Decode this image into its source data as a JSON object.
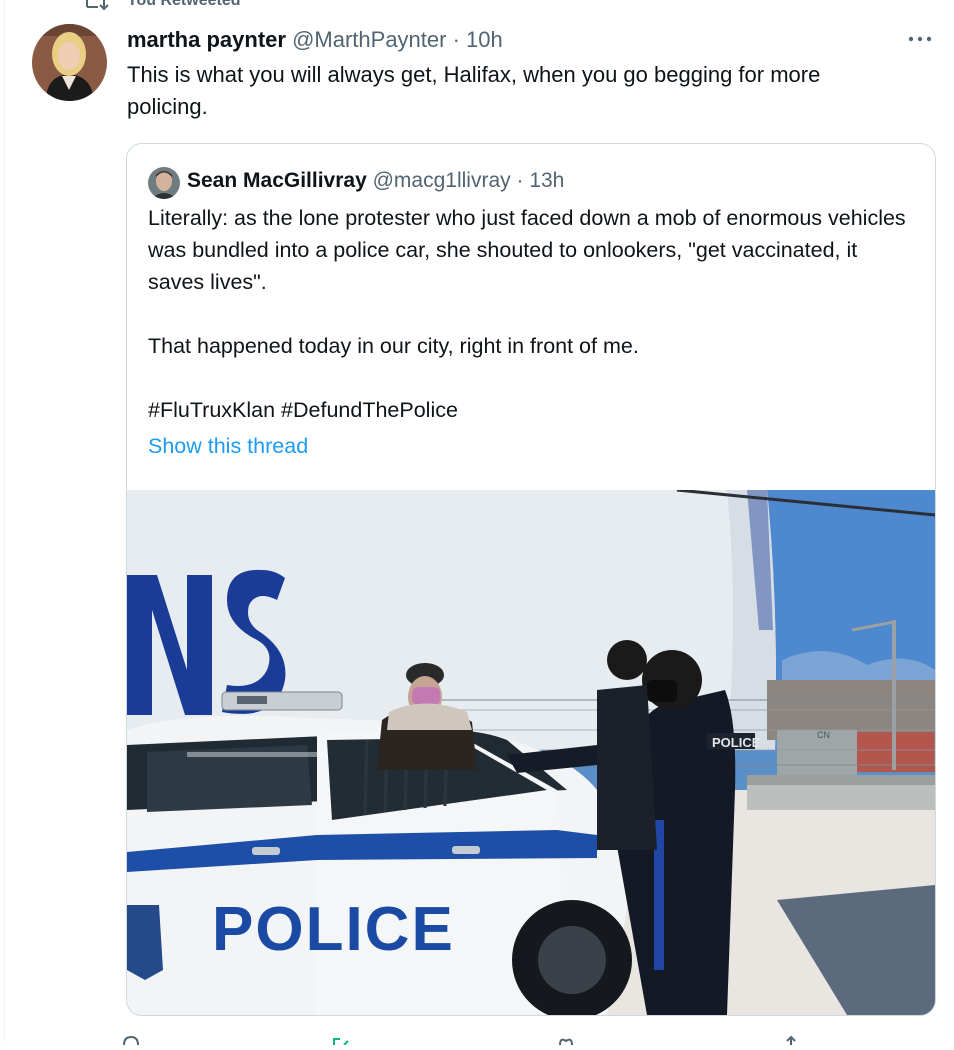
{
  "retweet": {
    "label": "You Retweeted",
    "icon": "retweet-icon"
  },
  "tweet": {
    "author_name": "martha paynter",
    "author_handle": "@MarthPaynter",
    "separator": "·",
    "time": "10h",
    "text": "This is what you will always get, Halifax, when you go begging for more policing.",
    "more_icon": "more-horizontal-icon"
  },
  "quote": {
    "author_name": "Sean MacGillivray",
    "author_handle": "@macg1llivray",
    "separator": "·",
    "time": "13h",
    "paragraph_1": "Literally: as the lone protester who just faced down a mob of enormous vehicles was bundled into a police car, she shouted to onlookers, \"get vaccinated, it saves lives\".",
    "paragraph_2": "That happened today in our city, right in front of me.",
    "paragraph_3": "#FluTruxKlan #DefundThePolice",
    "show_thread": "Show this thread",
    "media": {
      "wall_text": "NS",
      "car_text": "POLICE",
      "vest_text": "POLICE",
      "tank_text": "CN"
    }
  },
  "actions": [
    "reply-icon",
    "retweet-icon",
    "like-icon",
    "share-icon"
  ],
  "colors": {
    "link": "#1d9bf0",
    "muted": "#536471",
    "text": "#0f1419",
    "border": "#cfd9de",
    "retweet_active": "#00ba7c"
  }
}
